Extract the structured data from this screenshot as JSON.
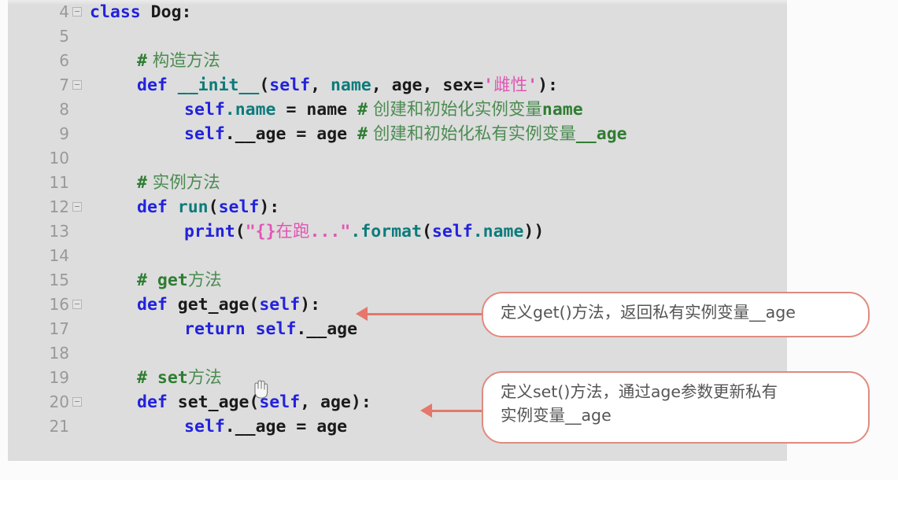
{
  "editor": {
    "language": "python",
    "background_color": "#dddddd",
    "gutter_text_color": "#999999",
    "partial_top_line_number": "3",
    "lines": [
      {
        "number": "4",
        "fold": true,
        "indent": 0
      },
      {
        "number": "5",
        "fold": false,
        "indent": 0
      },
      {
        "number": "6",
        "fold": false,
        "indent": 1
      },
      {
        "number": "7",
        "fold": true,
        "indent": 1
      },
      {
        "number": "8",
        "fold": false,
        "indent": 2
      },
      {
        "number": "9",
        "fold": false,
        "indent": 2
      },
      {
        "number": "10",
        "fold": false,
        "indent": 0
      },
      {
        "number": "11",
        "fold": false,
        "indent": 1
      },
      {
        "number": "12",
        "fold": true,
        "indent": 1
      },
      {
        "number": "13",
        "fold": false,
        "indent": 2
      },
      {
        "number": "14",
        "fold": false,
        "indent": 0
      },
      {
        "number": "15",
        "fold": false,
        "indent": 1
      },
      {
        "number": "16",
        "fold": true,
        "indent": 1
      },
      {
        "number": "17",
        "fold": false,
        "indent": 2
      },
      {
        "number": "18",
        "fold": false,
        "indent": 0
      },
      {
        "number": "19",
        "fold": false,
        "indent": 1
      },
      {
        "number": "20",
        "fold": true,
        "indent": 1
      },
      {
        "number": "21",
        "fold": false,
        "indent": 2
      }
    ],
    "code": {
      "l4_kw": "class",
      "l4_name": " Dog:",
      "l6_hash": "#",
      "l6_text": " 构造方法",
      "l7_def": "def",
      "l7_fn": " __init__",
      "l7_p1": "(",
      "l7_self": "self",
      "l7_p2": ", ",
      "l7_name": "name",
      "l7_p3": ", ",
      "l7_age": "age",
      "l7_p4": ", sex=",
      "l7_q1": "'",
      "l7_str": "雌性",
      "l7_q2": "'",
      "l7_p5": "):",
      "l8_self": "self",
      "l8_attr": ".name",
      "l8_eq": " = name ",
      "l8_hash": "#",
      "l8_cmt": " 创建和初始化实例变量",
      "l8_cmt_tail": "name",
      "l9_self": "self",
      "l9_attr": ".__age",
      "l9_eq": " = age ",
      "l9_hash": "#",
      "l9_cmt": " 创建和初始化私有实例变量",
      "l9_cmt_tail": "__age",
      "l11_hash": "#",
      "l11_text": " 实例方法",
      "l12_def": "def",
      "l12_fn": " run",
      "l12_p1": "(",
      "l12_self": "self",
      "l12_p2": "):",
      "l13_print": "print",
      "l13_p1": "(",
      "l13_q1": "\"{}",
      "l13_str": "在跑",
      "l13_q2": "...\"",
      "l13_dot": ".",
      "l13_fmt": "format",
      "l13_p2": "(",
      "l13_self": "self",
      "l13_attr": ".name",
      "l13_p3": "))",
      "l15_hash": "#",
      "l15_get": " get",
      "l15_text": "方法",
      "l16_def": "def",
      "l16_fn": " get_age",
      "l16_p1": "(",
      "l16_self": "self",
      "l16_p2": "):",
      "l17_return": "return",
      "l17_self": " self",
      "l17_attr": ".__age",
      "l19_hash": "#",
      "l19_set": " set",
      "l19_text": "方法",
      "l20_def": "def",
      "l20_fn": " set_age",
      "l20_p1": "(",
      "l20_self": "self",
      "l20_p2": ", ",
      "l20_age": "age",
      "l20_p3": "):",
      "l21_self": "self",
      "l21_attr": ".__age",
      "l21_eq": " = age"
    }
  },
  "annotations": {
    "border_color": "#e08a80",
    "arrow_color": "#e5776b",
    "callout_get": "定义get()方法，返回私有实例变量__age",
    "callout_set_line1": "定义set()方法，通过age参数更新私有",
    "callout_set_line2": "实例变量__age"
  },
  "cursor": {
    "type": "hand-cursor"
  }
}
